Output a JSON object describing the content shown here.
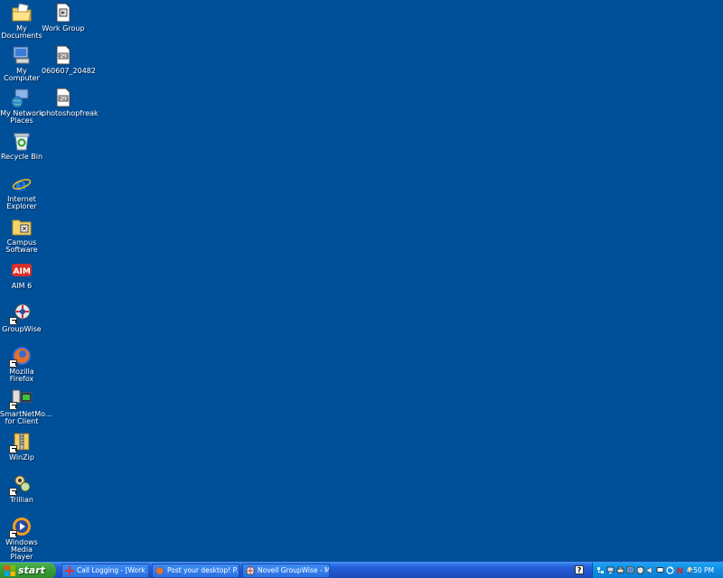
{
  "desktop": {
    "icons": [
      {
        "label": "My Documents",
        "icon": "folder-documents-icon"
      },
      {
        "label": "My Computer",
        "icon": "computer-icon"
      },
      {
        "label": "My Network Places",
        "icon": "network-places-icon"
      },
      {
        "label": "Recycle Bin",
        "icon": "recycle-bin-icon"
      },
      {
        "label": "Internet Explorer",
        "icon": "internet-explorer-icon"
      },
      {
        "label": "Campus Software",
        "icon": "folder-icon"
      },
      {
        "label": "AIM 6",
        "icon": "aim-icon"
      },
      {
        "label": "GroupWise",
        "icon": "groupwise-icon"
      },
      {
        "label": "Mozilla Firefox",
        "icon": "firefox-icon"
      },
      {
        "label": "SmartNetMo... for Client",
        "icon": "smartnet-icon"
      },
      {
        "label": "WinZip",
        "icon": "winzip-icon"
      },
      {
        "label": "Trillian",
        "icon": "trillian-icon"
      },
      {
        "label": "Windows Media Player",
        "icon": "media-player-icon"
      },
      {
        "label": "Work Group",
        "icon": "document-icon"
      },
      {
        "label": "060607_20482",
        "icon": "image-file-icon"
      },
      {
        "label": "photoshopfreak",
        "icon": "image-file-icon"
      }
    ]
  },
  "taskbar": {
    "start_label": "start",
    "tasks": [
      {
        "label": "Call Logging - [Work ...",
        "icon": "call-logging-icon"
      },
      {
        "label": "Post your desktop! P...",
        "icon": "firefox-icon"
      },
      {
        "label": "Novell GroupWise - M...",
        "icon": "groupwise-icon"
      }
    ],
    "help_label": "?",
    "clock": "4:50 PM"
  },
  "colors": {
    "desktop_background": "#004f99",
    "taskbar": "#245edb",
    "start_button": "#3a9e3a",
    "tray": "#0f8ae0"
  }
}
